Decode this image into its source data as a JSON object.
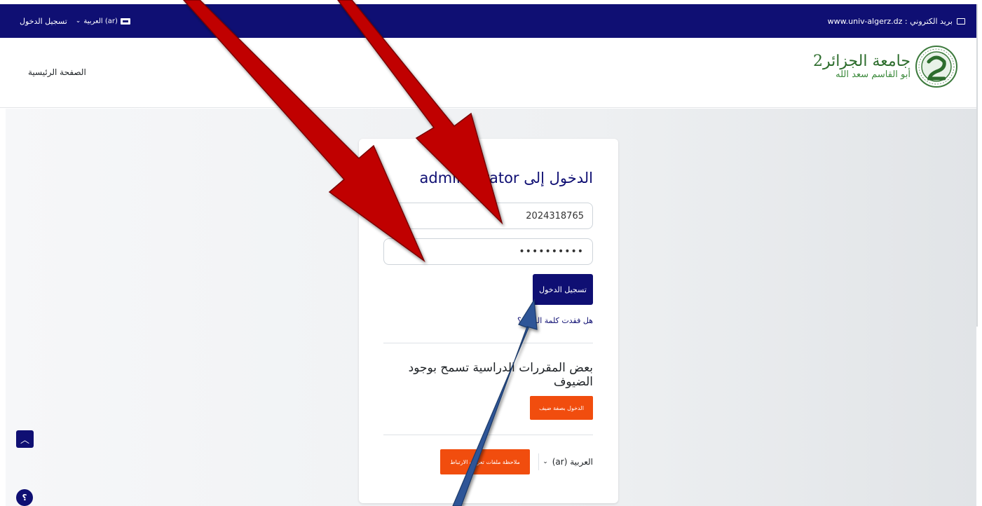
{
  "topbar": {
    "email_label": "بريد الكتروني : www.univ-algerz.dz",
    "language": "العربية ‎(ar)‎",
    "login_link": "تسجيل الدخول"
  },
  "header": {
    "home_link": "الصفحة الرئيسية",
    "logo_line1": "جامعة الجزائر2",
    "logo_line2": "أبو القاسم سعد الله"
  },
  "login": {
    "title": "الدخول إلى administrator",
    "username_value": "2024318765",
    "password_value": "••••••••••",
    "login_button": "تسجيل الدخول",
    "forgot_link": "هل فقدت كلمة المرور؟",
    "guest_heading": "بعض المقررات الدراسية تسمح بوجود الضيوف",
    "guest_button": "الدخول بصفة ضيف",
    "language_selector": "العربية ‎(ar)‎",
    "cookies_button": "ملاحظة ملفات تعريف الارتباط"
  },
  "floating": {
    "up_icon": "chevron-up-icon",
    "help_label": "؟"
  },
  "colors": {
    "primary": "#0f0f73",
    "accent": "#f14d0e",
    "arrow_red": "#c00000",
    "arrow_blue": "#2f5597"
  }
}
